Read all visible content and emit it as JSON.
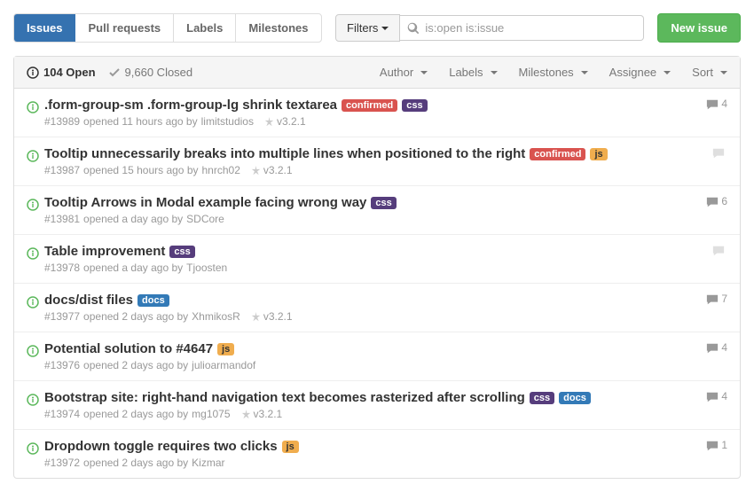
{
  "tabs": {
    "issues": "Issues",
    "pulls": "Pull requests",
    "labels": "Labels",
    "milestones": "Milestones"
  },
  "filters_btn": "Filters",
  "search_value": "is:open is:issue",
  "new_issue": "New issue",
  "counts": {
    "open": "104 Open",
    "closed": "9,660 Closed"
  },
  "header_filters": {
    "author": "Author",
    "labels": "Labels",
    "milestones": "Milestones",
    "assignee": "Assignee",
    "sort": "Sort"
  },
  "label_colors": {
    "confirmed": "#d9534f",
    "css": "#563d7c",
    "js": "#f0ad4e",
    "docs": "#337ab7"
  },
  "issues": [
    {
      "title": ".form-group-sm .form-group-lg shrink textarea",
      "labels": [
        "confirmed",
        "css"
      ],
      "number": "#13989",
      "meta": "opened 11 hours ago by",
      "author": "limitstudios",
      "milestone": "v3.2.1",
      "comments": 4,
      "faded": false
    },
    {
      "title": "Tooltip unnecessarily breaks into multiple lines when positioned to the right",
      "labels": [
        "confirmed",
        "js"
      ],
      "number": "#13987",
      "meta": "opened 15 hours ago by",
      "author": "hnrch02",
      "milestone": "v3.2.1",
      "comments": "",
      "faded": true
    },
    {
      "title": "Tooltip Arrows in Modal example facing wrong way",
      "labels": [
        "css"
      ],
      "number": "#13981",
      "meta": "opened a day ago by",
      "author": "SDCore",
      "milestone": "",
      "comments": 6,
      "faded": false
    },
    {
      "title": "Table improvement",
      "labels": [
        "css"
      ],
      "number": "#13978",
      "meta": "opened a day ago by",
      "author": "Tjoosten",
      "milestone": "",
      "comments": "",
      "faded": true
    },
    {
      "title": "docs/dist files",
      "labels": [
        "docs"
      ],
      "number": "#13977",
      "meta": "opened 2 days ago by",
      "author": "XhmikosR",
      "milestone": "v3.2.1",
      "comments": 7,
      "faded": false
    },
    {
      "title": "Potential solution to #4647",
      "labels": [
        "js"
      ],
      "number": "#13976",
      "meta": "opened 2 days ago by",
      "author": "julioarmandof",
      "milestone": "",
      "comments": 4,
      "faded": false
    },
    {
      "title": "Bootstrap site: right-hand navigation text becomes rasterized after scrolling",
      "labels": [
        "css",
        "docs"
      ],
      "number": "#13974",
      "meta": "opened 2 days ago by",
      "author": "mg1075",
      "milestone": "v3.2.1",
      "comments": 4,
      "faded": false
    },
    {
      "title": "Dropdown toggle requires two clicks",
      "labels": [
        "js"
      ],
      "number": "#13972",
      "meta": "opened 2 days ago by",
      "author": "Kizmar",
      "milestone": "",
      "comments": 1,
      "faded": false
    }
  ]
}
